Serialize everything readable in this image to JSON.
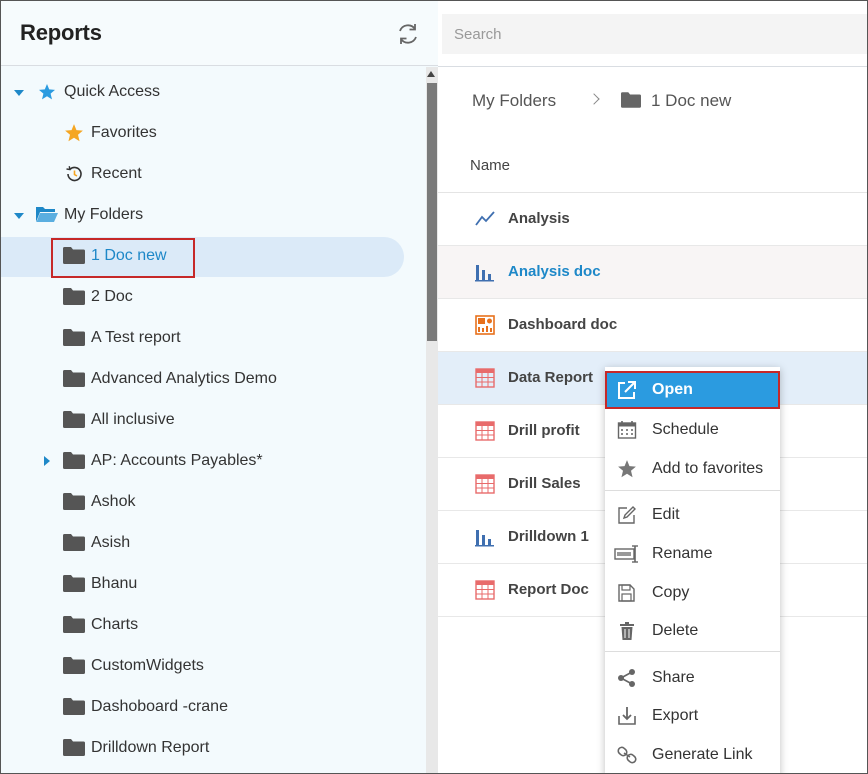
{
  "left": {
    "title": "Reports",
    "quick_access": "Quick Access",
    "favorites": "Favorites",
    "recent": "Recent",
    "my_folders": "My Folders",
    "folders": [
      "1 Doc new",
      "2 Doc",
      "A Test report",
      "Advanced Analytics Demo",
      "All inclusive",
      "AP: Accounts Payables*",
      "Ashok",
      "Asish",
      "Bhanu",
      "Charts",
      "CustomWidgets",
      "Dashoboard -crane",
      "Drilldown Report"
    ]
  },
  "right": {
    "search_placeholder": "Search",
    "breadcrumb": {
      "root": "My Folders",
      "current": "1 Doc new"
    },
    "column_name": "Name",
    "items": [
      {
        "label": "Analysis",
        "icon": "line-chart-icon"
      },
      {
        "label": "Analysis doc",
        "icon": "bar-chart-icon"
      },
      {
        "label": "Dashboard doc",
        "icon": "dashboard-icon"
      },
      {
        "label": "Data Report",
        "icon": "table-report-icon"
      },
      {
        "label": "Drill profit",
        "icon": "table-report-icon"
      },
      {
        "label": "Drill Sales",
        "icon": "table-report-icon"
      },
      {
        "label": "Drilldown 1",
        "icon": "bar-chart-icon"
      },
      {
        "label": "Report Doc",
        "icon": "table-report-icon"
      }
    ]
  },
  "menu": {
    "open": "Open",
    "schedule": "Schedule",
    "add_favorites": "Add to favorites",
    "edit": "Edit",
    "rename": "Rename",
    "copy": "Copy",
    "delete": "Delete",
    "share": "Share",
    "export": "Export",
    "generate_link": "Generate Link"
  },
  "colors": {
    "accent": "#2b9be0",
    "selected_text": "#1e88c8",
    "highlight_border": "#c62828"
  }
}
